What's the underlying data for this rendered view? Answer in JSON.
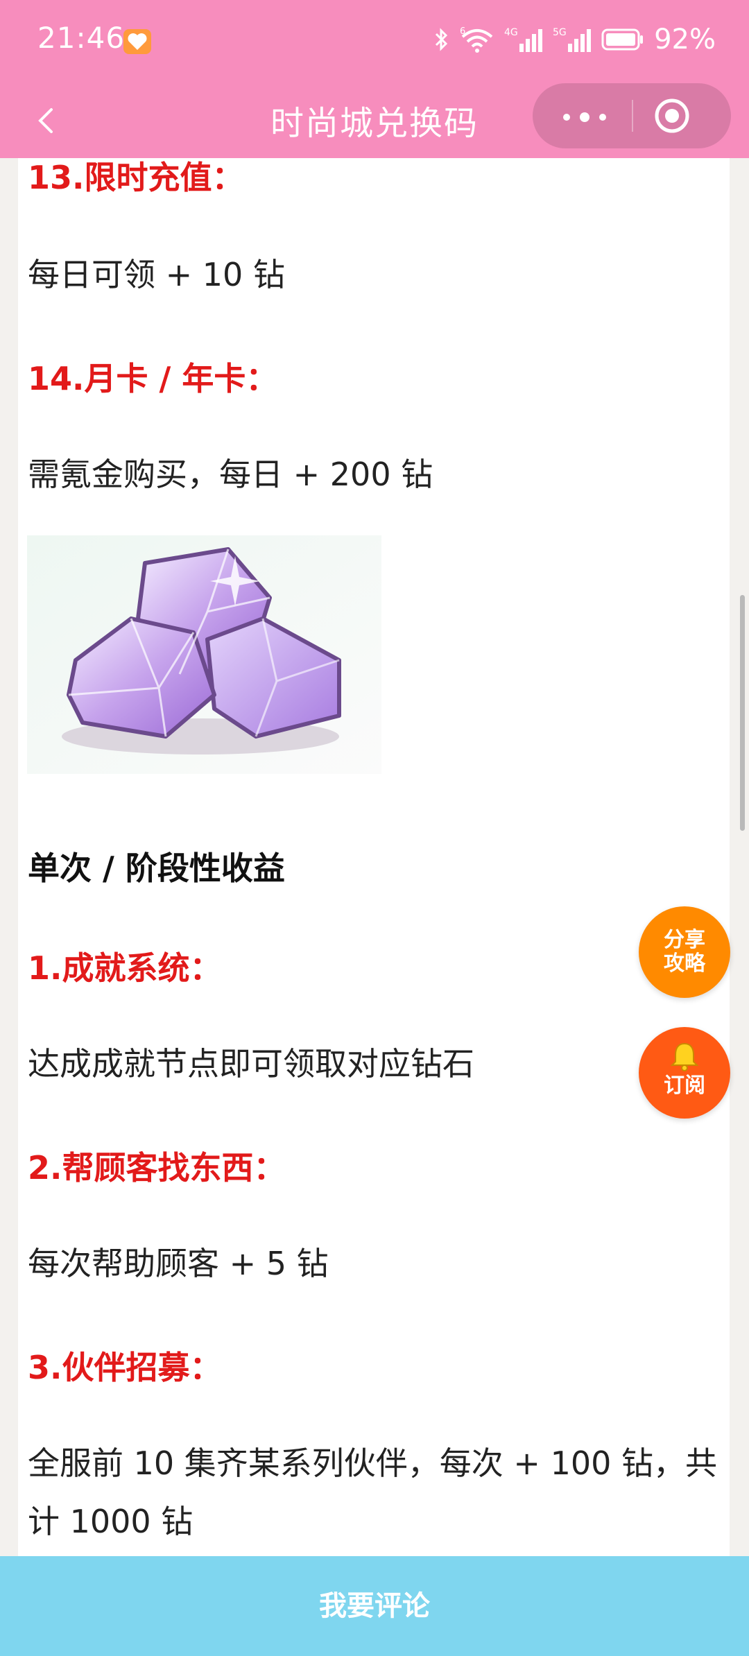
{
  "status_bar": {
    "time": "21:46",
    "battery_pct": "92%",
    "icons": [
      "heart-app-icon",
      "bluetooth-icon",
      "wifi-icon",
      "signal-4g-icon",
      "signal-5g-icon",
      "battery-icon"
    ],
    "net_4g": "4G",
    "net_5g": "5G",
    "wifi_sup": "6"
  },
  "header": {
    "title": "时尚城兑换码",
    "background": "#f78dbd",
    "icons": [
      "back-arrow-icon",
      "more-dots-icon",
      "target-icon"
    ]
  },
  "article": {
    "sections": [
      {
        "heading": "13.限时充值：",
        "text": "每日可领 + 10 钻"
      },
      {
        "heading": "14.月卡 / 年卡：",
        "text": "需氪金购买，每日 + 200 钻"
      },
      {
        "section_title": "单次 / 阶段性收益"
      },
      {
        "heading": "1.成就系统：",
        "text": "达成成就节点即可领取对应钻石"
      },
      {
        "heading": "2.帮顾客找东西：",
        "text": "每次帮助顾客 + 5 钻"
      },
      {
        "heading": "3.伙伴招募：",
        "text": "全服前 10 集齐某系列伙伴，每次 + 100 钻，共计 1000 钻"
      }
    ],
    "image": "purple-diamond-gems",
    "accent_color": "#e21a1a"
  },
  "floating": {
    "share": {
      "line1": "分享",
      "line2": "攻略",
      "color": "#ff8a00"
    },
    "subscribe": {
      "label": "订阅",
      "icon": "bell-icon",
      "color": "#ff5a14"
    }
  },
  "bottom": {
    "comment_label": "我要评论",
    "background": "#7fd6ef"
  }
}
